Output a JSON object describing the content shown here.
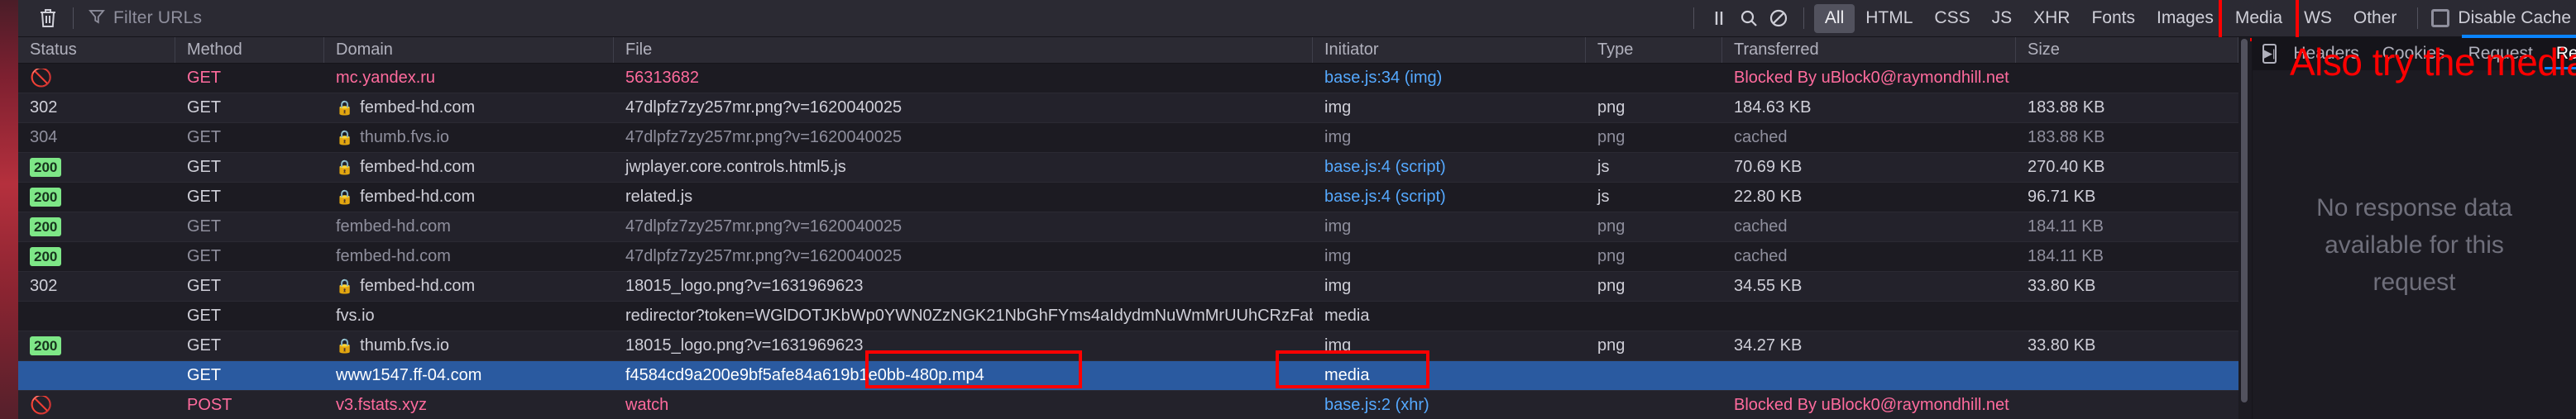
{
  "toolbar": {
    "clear_icon": "trash-icon",
    "filter_icon": "funnel-icon",
    "filter_placeholder": "Filter URLs",
    "pause_icon": "pause-icon",
    "search_icon": "search-icon",
    "block_icon": "no-entry-icon",
    "filters": [
      {
        "label": "All",
        "active": true,
        "highlight": false
      },
      {
        "label": "HTML",
        "active": false,
        "highlight": false
      },
      {
        "label": "CSS",
        "active": false,
        "highlight": false
      },
      {
        "label": "JS",
        "active": false,
        "highlight": false
      },
      {
        "label": "XHR",
        "active": false,
        "highlight": false
      },
      {
        "label": "Fonts",
        "active": false,
        "highlight": false
      },
      {
        "label": "Images",
        "active": false,
        "highlight": false
      },
      {
        "label": "Media",
        "active": false,
        "highlight": true
      },
      {
        "label": "WS",
        "active": false,
        "highlight": false
      },
      {
        "label": "Other",
        "active": false,
        "highlight": false
      }
    ],
    "persist_label": "Disable Cache"
  },
  "table": {
    "columns": [
      "Status",
      "Method",
      "Domain",
      "File",
      "Initiator",
      "Type",
      "Transferred",
      "Size"
    ],
    "rows": [
      {
        "status": "blocked",
        "status_text": "",
        "method": "GET",
        "domain": "mc.yandex.ru",
        "secure": false,
        "file": "56313682",
        "initiator": "base.js:34 (img)",
        "initiator_link": true,
        "type": "",
        "transferred": "Blocked By uBlock0@raymondhill.net",
        "size": "",
        "state": "blocked",
        "selected": false
      },
      {
        "status": "302",
        "status_text": "302",
        "method": "GET",
        "domain": "fembed-hd.com",
        "secure": true,
        "file": "47dlpfz7zy257mr.png?v=1620040025",
        "initiator": "img",
        "initiator_link": false,
        "type": "png",
        "transferred": "184.63 KB",
        "size": "183.88 KB",
        "state": "normal",
        "selected": false
      },
      {
        "status": "304",
        "status_text": "304",
        "method": "GET",
        "domain": "thumb.fvs.io",
        "secure": true,
        "file": "47dlpfz7zy257mr.png?v=1620040025",
        "initiator": "img",
        "initiator_link": false,
        "type": "png",
        "transferred": "cached",
        "size": "183.88 KB",
        "state": "cached",
        "selected": false
      },
      {
        "status": "200",
        "status_text": "200",
        "method": "GET",
        "domain": "fembed-hd.com",
        "secure": true,
        "file": "jwplayer.core.controls.html5.js",
        "initiator": "base.js:4 (script)",
        "initiator_link": true,
        "type": "js",
        "transferred": "70.69 KB",
        "size": "270.40 KB",
        "state": "normal",
        "selected": false
      },
      {
        "status": "200",
        "status_text": "200",
        "method": "GET",
        "domain": "fembed-hd.com",
        "secure": true,
        "file": "related.js",
        "initiator": "base.js:4 (script)",
        "initiator_link": true,
        "type": "js",
        "transferred": "22.80 KB",
        "size": "96.71 KB",
        "state": "normal",
        "selected": false
      },
      {
        "status": "200",
        "status_text": "200",
        "method": "GET",
        "domain": "fembed-hd.com",
        "secure": false,
        "file": "47dlpfz7zy257mr.png?v=1620040025",
        "initiator": "img",
        "initiator_link": false,
        "type": "png",
        "transferred": "cached",
        "size": "184.11 KB",
        "state": "cached",
        "selected": false
      },
      {
        "status": "200",
        "status_text": "200",
        "method": "GET",
        "domain": "fembed-hd.com",
        "secure": false,
        "file": "47dlpfz7zy257mr.png?v=1620040025",
        "initiator": "img",
        "initiator_link": false,
        "type": "png",
        "transferred": "cached",
        "size": "184.11 KB",
        "state": "cached",
        "selected": false
      },
      {
        "status": "302",
        "status_text": "302",
        "method": "GET",
        "domain": "fembed-hd.com",
        "secure": true,
        "file": "18015_logo.png?v=1631969623",
        "initiator": "img",
        "initiator_link": false,
        "type": "png",
        "transferred": "34.55 KB",
        "size": "33.80 KB",
        "state": "normal",
        "selected": false
      },
      {
        "status": "",
        "status_text": "",
        "method": "GET",
        "domain": "fvs.io",
        "secure": false,
        "file": "redirector?token=WGlDOTJKbWp0YWN0ZzNGK21NbGhFYms4aIdydmNuWmMrUUhCRzFabXhoSUJCTXhN",
        "initiator": "media",
        "initiator_link": false,
        "type": "",
        "transferred": "",
        "size": "",
        "state": "normal",
        "selected": false
      },
      {
        "status": "200",
        "status_text": "200",
        "method": "GET",
        "domain": "thumb.fvs.io",
        "secure": true,
        "file": "18015_logo.png?v=1631969623",
        "initiator": "img",
        "initiator_link": false,
        "type": "png",
        "transferred": "34.27 KB",
        "size": "33.80 KB",
        "state": "normal",
        "selected": false
      },
      {
        "status": "",
        "status_text": "",
        "method": "GET",
        "domain": "www1547.ff-04.com",
        "secure": false,
        "file": "f4584cd9a200e9bf5afe84a619b1e0bb-480p.mp4",
        "initiator": "media",
        "initiator_link": false,
        "type": "",
        "transferred": "",
        "size": "",
        "state": "normal",
        "selected": true
      },
      {
        "status": "blocked",
        "status_text": "",
        "method": "POST",
        "domain": "v3.fstats.xyz",
        "secure": false,
        "file": "watch",
        "initiator": "base.js:2 (xhr)",
        "initiator_link": true,
        "type": "",
        "transferred": "Blocked By uBlock0@raymondhill.net",
        "size": "",
        "state": "blocked",
        "selected": false
      }
    ]
  },
  "details": {
    "play_icon": "media-preview-icon",
    "tabs": [
      {
        "label": "Headers",
        "active": false
      },
      {
        "label": "Cookies",
        "active": false
      },
      {
        "label": "Request",
        "active": false
      },
      {
        "label": "Response",
        "active": true
      }
    ],
    "empty_message": "No response data available for this\nrequest"
  },
  "annotations": {
    "note_text": "Also try the media filter",
    "note_color": "#ff0000"
  }
}
